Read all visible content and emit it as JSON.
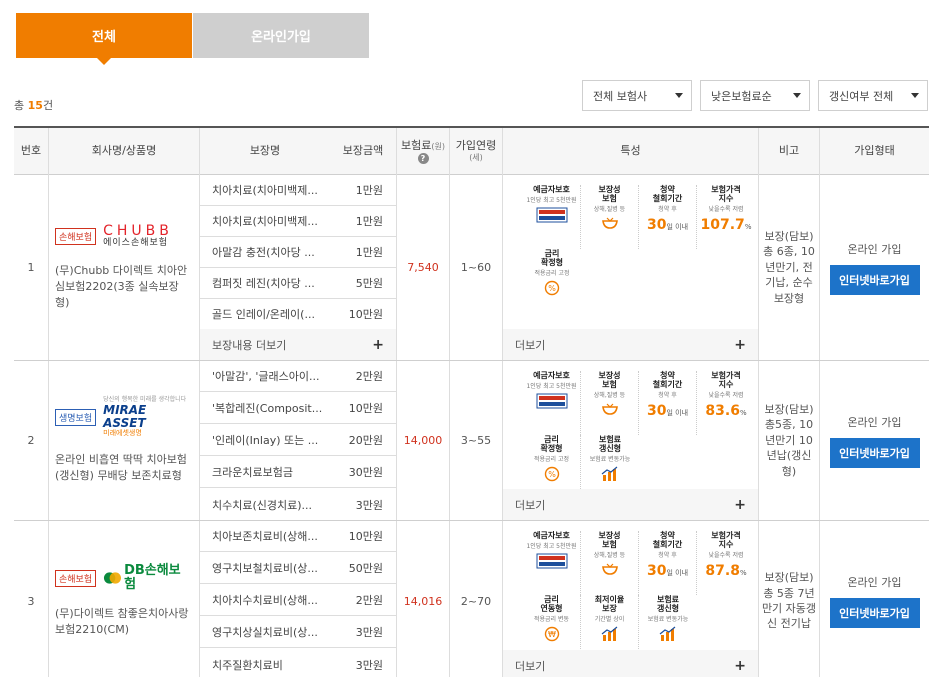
{
  "tabs": [
    {
      "label": "전체",
      "active": true
    },
    {
      "label": "온라인가입",
      "active": false
    }
  ],
  "total": {
    "prefix": "총",
    "count": "15",
    "suffix": "건"
  },
  "filters": [
    {
      "value": "전체 보험사"
    },
    {
      "value": "낮은보험료순"
    },
    {
      "value": "갱신여부 전체"
    }
  ],
  "header": {
    "no": "번호",
    "company": "회사명/상품명",
    "coverage": "보장명",
    "amount": "보장금액",
    "premium": "보험료",
    "premium_unit": "(원)",
    "age": "가입연령",
    "age_unit": "(세)",
    "feature": "특성",
    "note": "비고",
    "join": "가입형태"
  },
  "colors": {
    "accent": "#f07d00",
    "price": "#d0321e",
    "button": "#1d73c9"
  },
  "rows": [
    {
      "no": "1",
      "badge": "손해보험",
      "logo": {
        "line1": "CHUBB",
        "line2": "에이스손해보험"
      },
      "product": "(무)Chubb 다이렉트 치아안심보험2202(3종 실속보장형)",
      "coverages": [
        {
          "name": "치아치료(치아미백제...",
          "amount": "1만원"
        },
        {
          "name": "치아치료(치아미백제...",
          "amount": "1만원"
        },
        {
          "name": "아말감 충전(치아당 ...",
          "amount": "1만원"
        },
        {
          "name": "컴퍼짓 레진(치아당 ...",
          "amount": "5만원"
        },
        {
          "name": "골드 인레이/온레이(...",
          "amount": "10만원"
        }
      ],
      "coverage_more": "보장내용 더보기",
      "premium": "7,540",
      "age": "1~60",
      "features": [
        {
          "title": "예금자보호",
          "sub1": "1인당",
          "sub2": "최고 5천만원",
          "icon": "deposit-protection-icon"
        },
        {
          "title": "보장성\n보험",
          "sub1": "상해,질병 등",
          "icon": "bowl-icon"
        },
        {
          "title": "청약\n철회기간",
          "sub1": "청약 후",
          "value": "30",
          "unit": "일 이내"
        },
        {
          "title": "보험가격\n지수",
          "sub1": "낮을수록 저렴",
          "value": "107.7",
          "unit": "%"
        },
        {
          "title": "금리\n확정형",
          "sub1": "적용금리 고정",
          "icon": "percent-icon"
        }
      ],
      "feature_more": "더보기",
      "note": "보장(담보) 총 6종, 10년만기, 전기납, 순수보장형",
      "join_type": "온라인 가입",
      "join_button": "인터넷바로가입"
    },
    {
      "no": "2",
      "badge": "생명보험",
      "logo": {
        "line0": "당신의 행복한 미래를 생각합니다",
        "line1": "MIRAE ASSET",
        "line2": "미래에셋생명"
      },
      "product": "온라인 비흡연 딱딱 치아보험(갱신형) 무배당 보존치료형",
      "coverages": [
        {
          "name": "'아말감', '글래스아이...",
          "amount": "2만원"
        },
        {
          "name": "'복합레진(Composit...",
          "amount": "10만원"
        },
        {
          "name": "'인레이(Inlay) 또는 ...",
          "amount": "20만원"
        },
        {
          "name": "크라운치료보험금",
          "amount": "30만원"
        },
        {
          "name": "치수치료(신경치료)...",
          "amount": "3만원"
        }
      ],
      "premium": "14,000",
      "age": "3~55",
      "features": [
        {
          "title": "예금자보호",
          "sub1": "1인당",
          "sub2": "최고 5천만원",
          "icon": "deposit-protection-icon"
        },
        {
          "title": "보장성\n보험",
          "sub1": "상해,질병 등",
          "icon": "bowl-icon"
        },
        {
          "title": "청약\n철회기간",
          "sub1": "청약 후",
          "value": "30",
          "unit": "일 이내"
        },
        {
          "title": "보험가격\n지수",
          "sub1": "낮을수록 저렴",
          "value": "83.6",
          "unit": "%"
        },
        {
          "title": "금리\n확정형",
          "sub1": "적용금리 고정",
          "icon": "percent-icon"
        },
        {
          "title": "보험료\n갱신형",
          "sub1": "보험료 변동가능",
          "icon": "chart-icon"
        }
      ],
      "feature_more": "더보기",
      "note": "보장(담보)총5종, 10년만기 10년납(갱신형)",
      "join_type": "온라인 가입",
      "join_button": "인터넷바로가입"
    },
    {
      "no": "3",
      "badge": "손해보험",
      "logo": {
        "line1": "DB손해보험"
      },
      "product": "(무)다이렉트 참좋은치아사랑보험2210(CM)",
      "coverages": [
        {
          "name": "치아보존치료비(상해...",
          "amount": "10만원"
        },
        {
          "name": "영구치보철치료비(상...",
          "amount": "50만원"
        },
        {
          "name": "치아치수치료비(상해...",
          "amount": "2만원"
        },
        {
          "name": "영구치상실치료비(상...",
          "amount": "3만원"
        },
        {
          "name": "치주질환치료비",
          "amount": "3만원"
        }
      ],
      "premium": "14,016",
      "age": "2~70",
      "features": [
        {
          "title": "예금자보호",
          "sub1": "1인당",
          "sub2": "최고 5천만원",
          "icon": "deposit-protection-icon"
        },
        {
          "title": "보장성\n보험",
          "sub1": "상해,질병 등",
          "icon": "bowl-icon"
        },
        {
          "title": "청약\n철회기간",
          "sub1": "청약 후",
          "value": "30",
          "unit": "일 이내"
        },
        {
          "title": "보험가격\n지수",
          "sub1": "낮을수록 저렴",
          "value": "87.8",
          "unit": "%"
        },
        {
          "title": "금리\n연동형",
          "sub1": "적용금리 변동",
          "icon": "won-icon"
        },
        {
          "title": "최저이율\n보장",
          "sub1": "기간별 상이",
          "icon": "chart-icon"
        },
        {
          "title": "보험료\n갱신형",
          "sub1": "보험료 변동가능",
          "icon": "chart-icon"
        }
      ],
      "feature_more": "더보기",
      "note": "보장(담보) 총 5종 7년만기 자동갱신 전기납",
      "join_type": "온라인 가입",
      "join_button": "인터넷바로가입"
    }
  ]
}
